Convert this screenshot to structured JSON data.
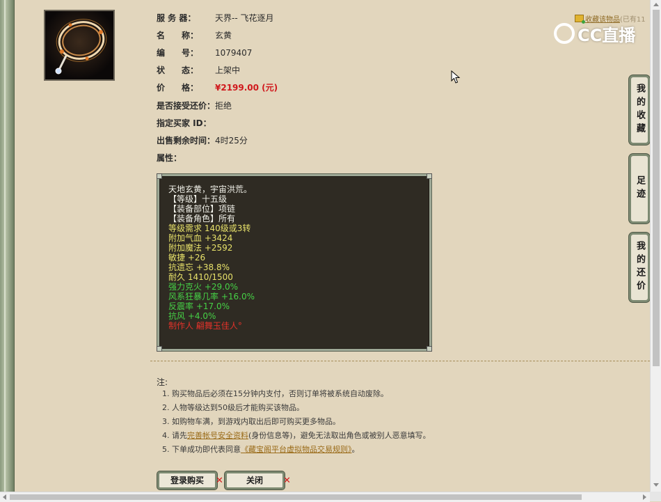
{
  "item": {
    "server_label": "服 务 器：",
    "server_value": "天界-- 飞花逐月",
    "name_label": "名　　称：",
    "name_value": "玄黄",
    "id_label": "编　　号：",
    "id_value": "1079407",
    "status_label": "状　　态：",
    "status_value": "上架中",
    "price_label": "价　　格：",
    "price_value": "¥2199.00 (元)",
    "counter_label": "是否接受还价：",
    "counter_value": "拒绝",
    "buyer_label": "指定买家 ID：",
    "buyer_value": "",
    "time_label": "出售剩余时间：",
    "time_value": "4时25分",
    "attr_label": "属性："
  },
  "favorite": {
    "link": "收藏该物品",
    "count": "(已有11"
  },
  "watermark": "CC直播",
  "attributes": [
    {
      "text": "天地玄黄，宇宙洪荒。",
      "color": "#f2f2ea"
    },
    {
      "text": "【等级】十五级",
      "color": "#f2f2ea"
    },
    {
      "text": "【装备部位】项链",
      "color": "#f2f2ea"
    },
    {
      "text": "【装备角色】所有",
      "color": "#f2f2ea"
    },
    {
      "text": "等级需求 140级或3转",
      "color": "#e8e26a"
    },
    {
      "text": "附加气血 +3424",
      "color": "#e8e26a"
    },
    {
      "text": "附加魔法 +2592",
      "color": "#e8e26a"
    },
    {
      "text": "敏捷 +26",
      "color": "#e8e26a"
    },
    {
      "text": "抗遗忘 +38.8%",
      "color": "#e8e26a"
    },
    {
      "text": "耐久 1410/1500",
      "color": "#e8e26a"
    },
    {
      "text": "强力克火 +29.0%",
      "color": "#46d146"
    },
    {
      "text": "风系狂暴几率 +16.0%",
      "color": "#46d146"
    },
    {
      "text": "反震率 +17.0%",
      "color": "#46d146"
    },
    {
      "text": "抗风 +4.0%",
      "color": "#46d146"
    },
    {
      "text": "制作人 翩舞玉佳人°",
      "color": "#e0322a"
    }
  ],
  "notes": {
    "title": "注:",
    "n1": "1. 购买物品后必须在15分钟内支付，否则订单将被系统自动废除。",
    "n2": "2. 人物等级达到50级后才能购买该物品。",
    "n3": "3. 如购物车满，到游戏内取出后即可购买更多物品。",
    "n4_pre": "4. 请先",
    "n4_link": "完善帐号安全资料",
    "n4_post": "(身份信息等)，避免无法取出角色或被别人恶意填写。",
    "n5_pre": "5. 下单成功即代表同意",
    "n5_link": "《藏宝阁平台虚拟物品交易规则》",
    "n5_post": "。"
  },
  "buttons": {
    "login_buy": "登录购买",
    "close": "关闭",
    "x_mark": "✕"
  },
  "side_tabs": {
    "favorites": "我的收藏",
    "history": "足迹",
    "bargain": "我的还价"
  }
}
